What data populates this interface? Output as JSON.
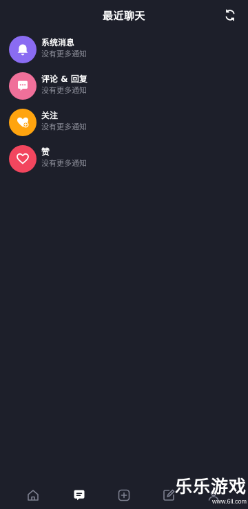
{
  "header": {
    "title": "最近聊天"
  },
  "messages": [
    {
      "title": "系统消息",
      "subtitle": "没有更多通知",
      "icon": "bell-icon",
      "color": "#8a6cf2"
    },
    {
      "title": "评论 & 回复",
      "subtitle": "没有更多通知",
      "icon": "comment-icon",
      "color": "#f0709a"
    },
    {
      "title": "关注",
      "subtitle": "没有更多通知",
      "icon": "follow-heart-icon",
      "color": "#ffa40f"
    },
    {
      "title": "赞",
      "subtitle": "没有更多通知",
      "icon": "heart-icon",
      "color": "#f2465e"
    }
  ],
  "tabbar": {
    "active_tab": "messages",
    "tabs": [
      "home-icon",
      "message-icon",
      "add-icon",
      "edit-icon",
      "profile-icon"
    ]
  },
  "watermark": {
    "main": "乐乐游戏",
    "sub": "www.6ll.com"
  },
  "colors": {
    "background": "#1d1f2a",
    "subtitle": "#8b8d98",
    "icon_inactive": "#7d8090"
  }
}
